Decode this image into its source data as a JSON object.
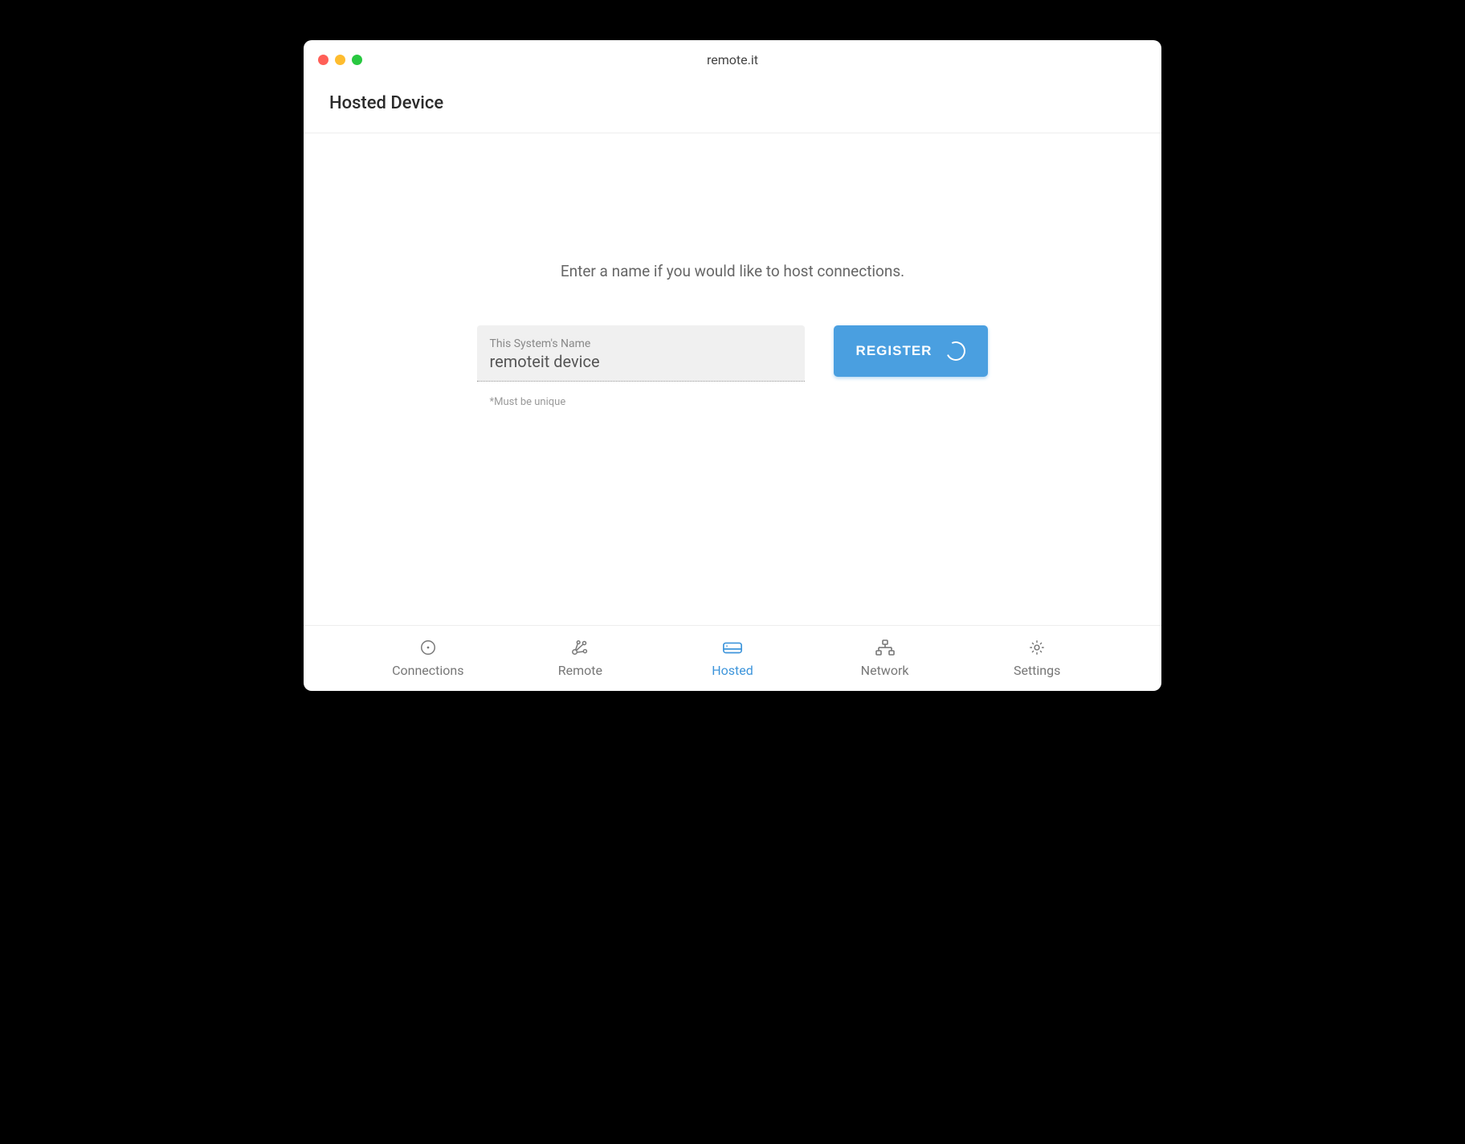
{
  "window": {
    "title": "remote.it"
  },
  "page": {
    "heading": "Hosted Device",
    "prompt": "Enter a name if you would like to host connections.",
    "input": {
      "label": "This System's Name",
      "value": "remoteit device",
      "hint": "*Must be unique"
    },
    "register_button": {
      "label": "REGISTER"
    }
  },
  "tabs": {
    "connections": {
      "label": "Connections"
    },
    "remote": {
      "label": "Remote"
    },
    "hosted": {
      "label": "Hosted"
    },
    "network": {
      "label": "Network"
    },
    "settings": {
      "label": "Settings"
    }
  },
  "colors": {
    "accent": "#4a9fe0"
  }
}
